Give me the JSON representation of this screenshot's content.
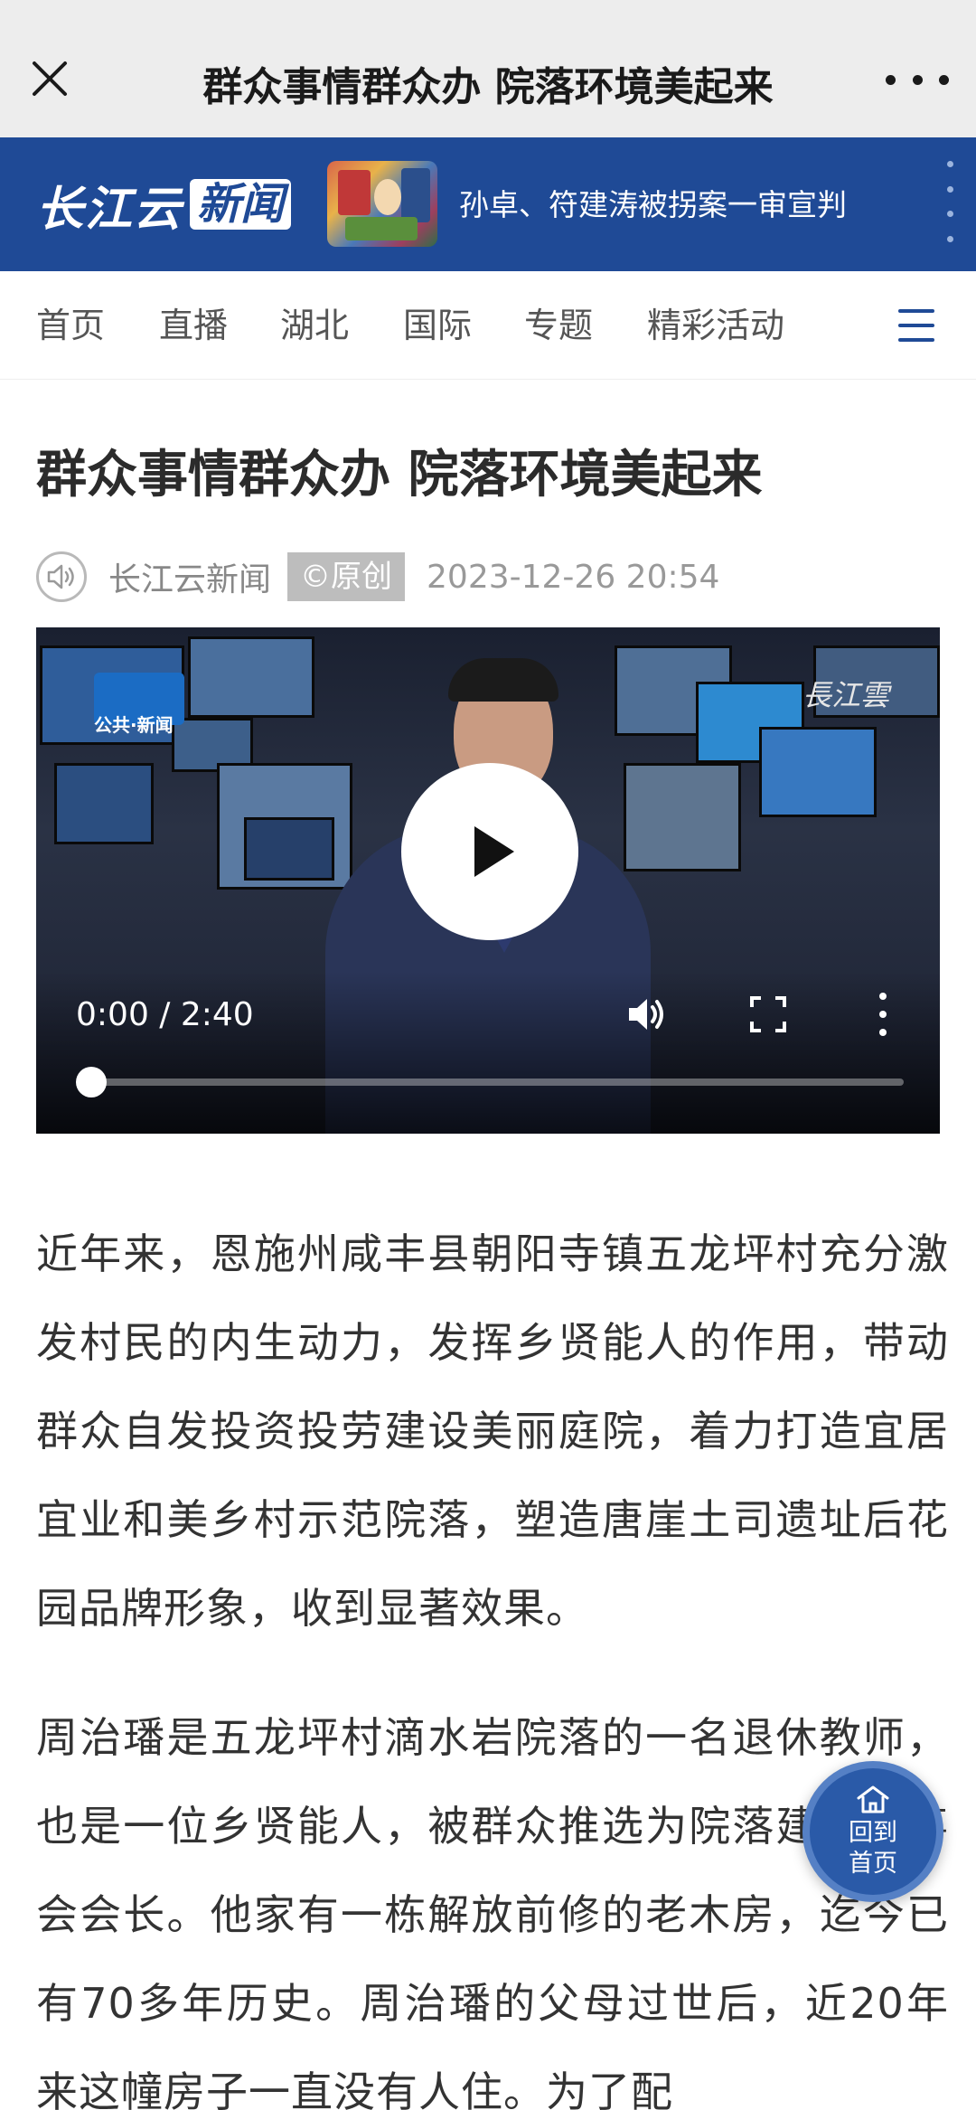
{
  "topbar": {
    "title": "群众事情群众办 院落环境美起来",
    "close_icon": "close-icon",
    "more_icon": "more-icon"
  },
  "brand": {
    "logo_part1": "长江云",
    "logo_part2": "新闻",
    "headline": "孙卓、符建涛被拐案一审宣判",
    "colors": {
      "brand_blue": "#1f4a96"
    }
  },
  "nav": {
    "items": [
      "首页",
      "直播",
      "湖北",
      "国际",
      "专题",
      "精彩活动"
    ],
    "menu_icon": "menu-icon"
  },
  "article": {
    "title": "群众事情群众办 院落环境美起来",
    "source": "长江云新闻",
    "original_badge": "©原创",
    "datetime": "2023-12-26 20:54"
  },
  "video": {
    "station_logo_text": "公共·新闻",
    "watermark": "長江雲",
    "time": "0:00 / 2:40",
    "progress_fraction": 0.0
  },
  "body": {
    "paragraph1": "近年来，恩施州咸丰县朝阳寺镇五龙坪村充分激发村民的内生动力，发挥乡贤能人的作用，带动群众自发投资投劳建设美丽庭院，着力打造宜居宜业和美乡村示范院落，塑造唐崖土司遗址后花园品牌形象，收到显著效果。",
    "paragraph2": "周治璠是五龙坪村滴水岩院落的一名退休教师，也是一位乡贤能人，被群众推选为院落建设理事会会长。他家有一栋解放前修的老木房，迄今已有70多年历史。周治璠的父母过世后，近20年来这幢房子一直没有人住。为了配"
  },
  "home_button": {
    "label": "回到\n首页"
  }
}
